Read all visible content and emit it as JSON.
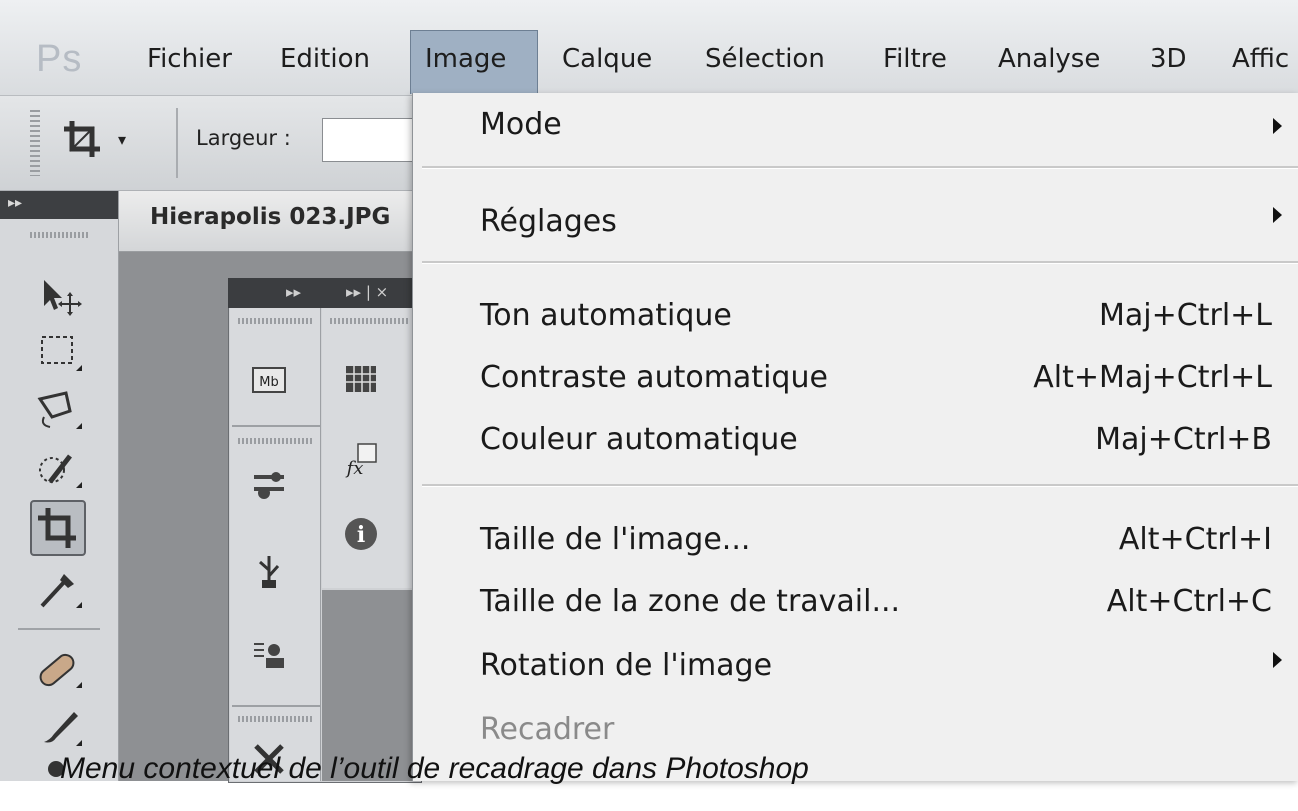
{
  "app": {
    "logo": "Ps"
  },
  "menubar": {
    "items": [
      "Fichier",
      "Edition",
      "Image",
      "Calque",
      "Sélection",
      "Filtre",
      "Analyse",
      "3D",
      "Affic"
    ],
    "active_index": 2
  },
  "options_bar": {
    "largeur_label": "Largeur :",
    "largeur_value": ""
  },
  "document": {
    "title": "Hierapolis 023.JPG"
  },
  "panel": {
    "header_left": "▸▸",
    "header_right": "▸▸ | ×",
    "icons": [
      "mini-bridge-icon",
      "swatches-icon",
      "adjustments-icon",
      "fx-styles-icon",
      "usb-icon",
      "info-icon",
      "clone-source-icon",
      "tools-icon"
    ]
  },
  "toolbox": {
    "tools": [
      "move-tool-icon",
      "marquee-tool-icon",
      "lasso-tool-icon",
      "quick-selection-tool-icon",
      "crop-tool-icon",
      "eyedropper-tool-icon",
      "healing-brush-tool-icon",
      "brush-tool-icon",
      "stamp-tool-icon"
    ],
    "selected_tool": "crop-tool-icon"
  },
  "dropdown": {
    "items": [
      {
        "label": "Mode",
        "shortcut": "",
        "submenu": true,
        "enabled": true
      },
      {
        "label": "Réglages",
        "shortcut": "",
        "submenu": true,
        "enabled": true
      },
      {
        "label": "Ton automatique",
        "shortcut": "Maj+Ctrl+L",
        "submenu": false,
        "enabled": true
      },
      {
        "label": "Contraste automatique",
        "shortcut": "Alt+Maj+Ctrl+L",
        "submenu": false,
        "enabled": true
      },
      {
        "label": "Couleur automatique",
        "shortcut": "Maj+Ctrl+B",
        "submenu": false,
        "enabled": true
      },
      {
        "label": "Taille de l'image...",
        "shortcut": "Alt+Ctrl+I",
        "submenu": false,
        "enabled": true
      },
      {
        "label": "Taille de la zone de travail...",
        "shortcut": "Alt+Ctrl+C",
        "submenu": false,
        "enabled": true
      },
      {
        "label": "Rotation de l'image",
        "shortcut": "",
        "submenu": true,
        "enabled": true
      },
      {
        "label": "Recadrer",
        "shortcut": "",
        "submenu": false,
        "enabled": false
      }
    ]
  },
  "caption": {
    "text": "Menu contextuel de l’outil de recadrage dans Photoshop"
  },
  "colors": {
    "menu_active": "#9fb0c3",
    "dropdown_bg": "#f0f0f0",
    "workspace": "#8e9093"
  }
}
